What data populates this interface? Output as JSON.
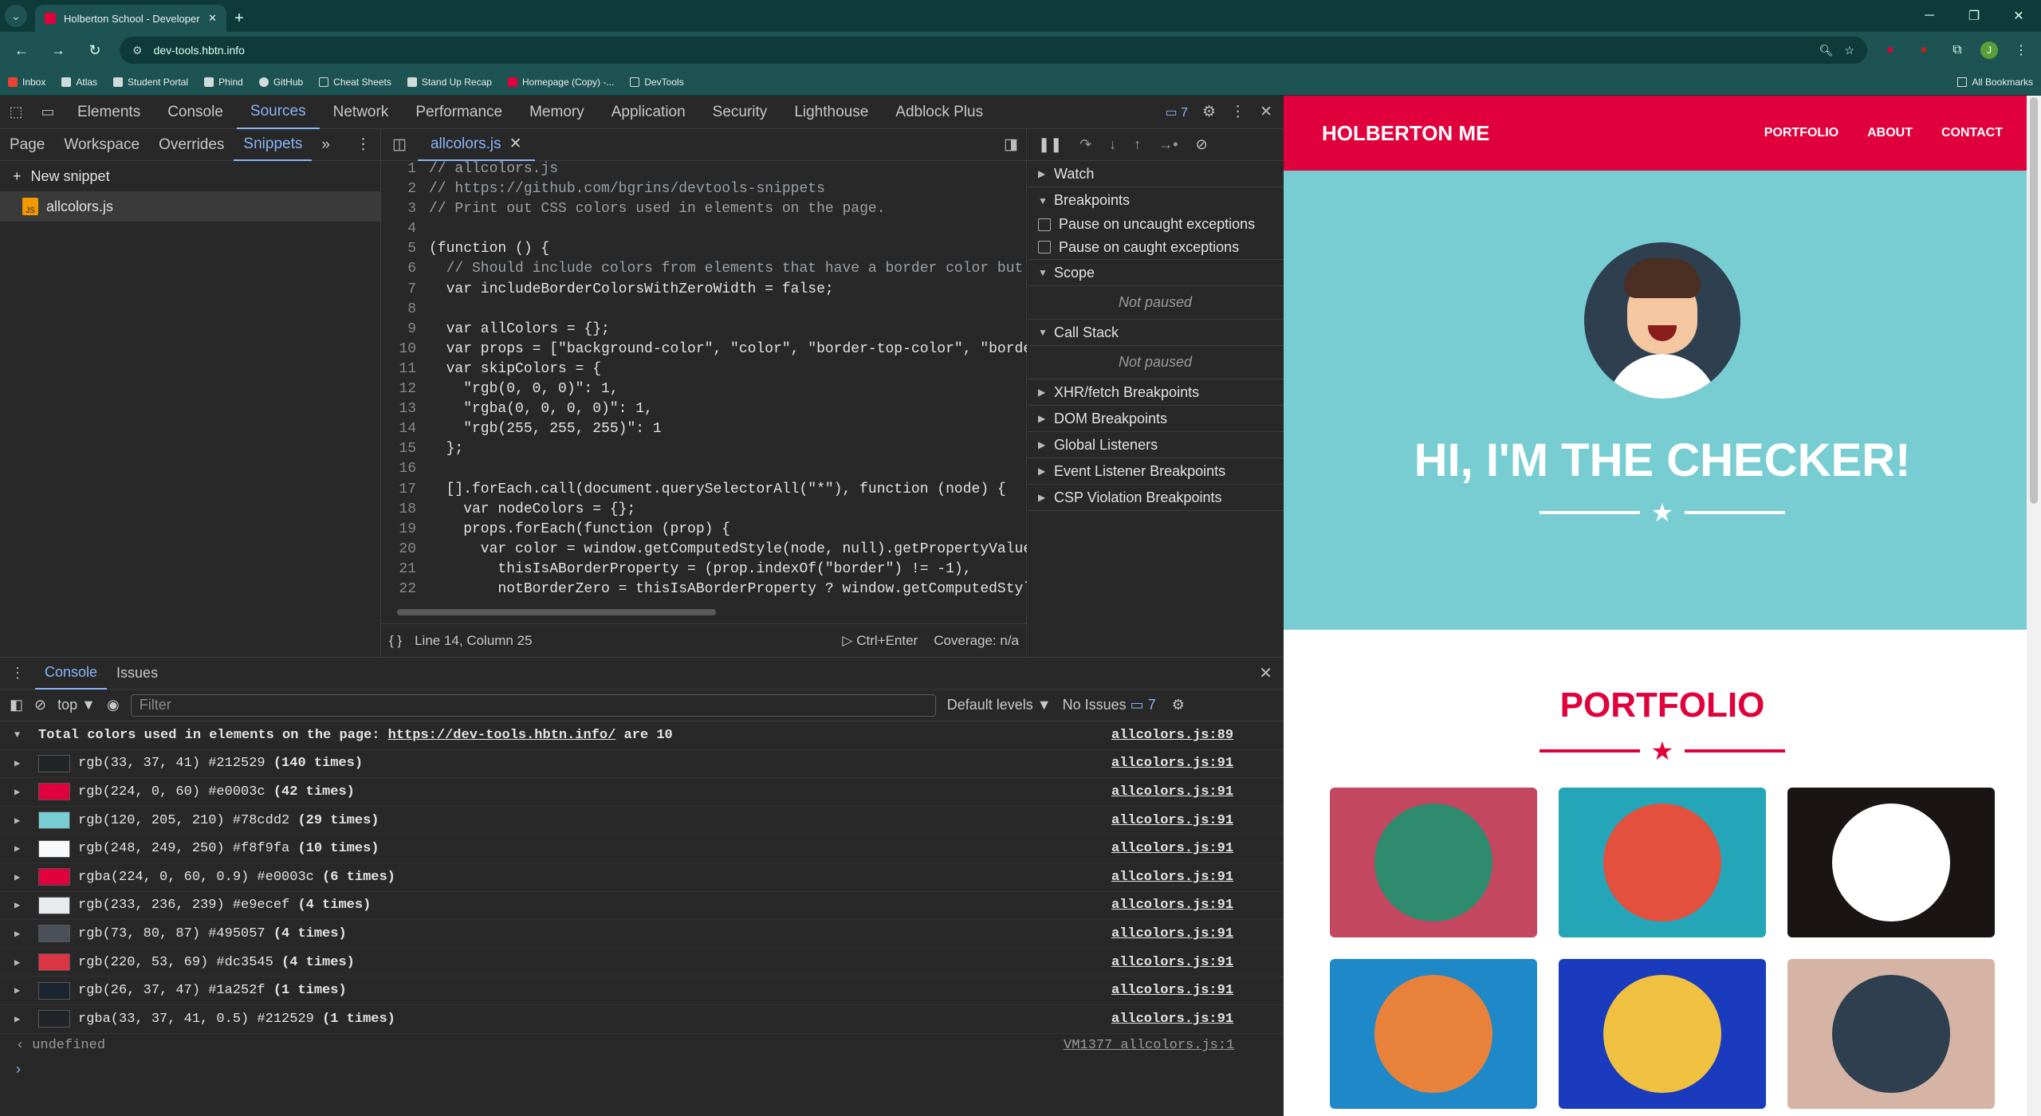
{
  "browser": {
    "tab_title": "Holberton School - Developer",
    "url": "dev-tools.hbtn.info",
    "bookmarks": [
      "Inbox",
      "Atlas",
      "Student Portal",
      "Phind",
      "GitHub",
      "Cheat Sheets",
      "Stand Up Recap",
      "Homepage (Copy) -...",
      "DevTools"
    ],
    "all_bookmarks": "All Bookmarks",
    "profile_initial": "J"
  },
  "devtools": {
    "tabs": [
      "Elements",
      "Console",
      "Sources",
      "Network",
      "Performance",
      "Memory",
      "Application",
      "Security",
      "Lighthouse",
      "Adblock Plus"
    ],
    "active_tab": "Sources",
    "issues_badge": "7",
    "nav_tabs": [
      "Page",
      "Workspace",
      "Overrides",
      "Snippets"
    ],
    "new_snippet": "New snippet",
    "snippet_file": "allcolors.js",
    "editor_tab": "allcolors.js",
    "code_lines": [
      "// allcolors.js",
      "// https://github.com/bgrins/devtools-snippets",
      "// Print out CSS colors used in elements on the page.",
      "",
      "(function () {",
      "  // Should include colors from elements that have a border color but h",
      "  var includeBorderColorsWithZeroWidth = false;",
      "",
      "  var allColors = {};",
      "  var props = [\"background-color\", \"color\", \"border-top-color\", \"border",
      "  var skipColors = {",
      "    \"rgb(0, 0, 0)\": 1,",
      "    \"rgba(0, 0, 0, 0)\": 1,",
      "    \"rgb(255, 255, 255)\": 1",
      "  };",
      "",
      "  [].forEach.call(document.querySelectorAll(\"*\"), function (node) {",
      "    var nodeColors = {};",
      "    props.forEach(function (prop) {",
      "      var color = window.getComputedStyle(node, null).getPropertyValue(",
      "        thisIsABorderProperty = (prop.indexOf(\"border\") != -1),",
      "        notBorderZero = thisIsABorderProperty ? window.getComputedStyle"
    ],
    "status_position": "Line 14, Column 25",
    "run_hint": "Ctrl+Enter",
    "coverage": "Coverage: n/a",
    "debugger": {
      "watch": "Watch",
      "breakpoints": "Breakpoints",
      "pause_uncaught": "Pause on uncaught exceptions",
      "pause_caught": "Pause on caught exceptions",
      "scope": "Scope",
      "not_paused": "Not paused",
      "call_stack": "Call Stack",
      "more_sections": [
        "XHR/fetch Breakpoints",
        "DOM Breakpoints",
        "Global Listeners",
        "Event Listener Breakpoints",
        "CSP Violation Breakpoints"
      ]
    },
    "drawer": {
      "tabs": [
        "Console",
        "Issues"
      ],
      "context": "top",
      "filter_placeholder": "Filter",
      "levels": "Default levels",
      "no_issues": "No Issues",
      "issues_count": "7",
      "summary_prefix": "Total colors used in elements on the page: ",
      "summary_link": "https://dev-tools.hbtn.info/",
      "summary_suffix": " are 10",
      "summary_src": "allcolors.js:89",
      "color_rows": [
        {
          "text": "rgb(33, 37, 41) #212529 ",
          "count": "(140 times)",
          "swatch": "#212529",
          "src": "allcolors.js:91"
        },
        {
          "text": "rgb(224, 0, 60) #e0003c ",
          "count": "(42 times)",
          "swatch": "#e0003c",
          "src": "allcolors.js:91"
        },
        {
          "text": "rgb(120, 205, 210) #78cdd2 ",
          "count": "(29 times)",
          "swatch": "#78cdd2",
          "src": "allcolors.js:91"
        },
        {
          "text": "rgb(248, 249, 250) #f8f9fa ",
          "count": "(10 times)",
          "swatch": "#f8f9fa",
          "src": "allcolors.js:91"
        },
        {
          "text": "rgba(224, 0, 60, 0.9) #e0003c ",
          "count": "(6 times)",
          "swatch": "#e0003c",
          "src": "allcolors.js:91"
        },
        {
          "text": "rgb(233, 236, 239) #e9ecef ",
          "count": "(4 times)",
          "swatch": "#e9ecef",
          "src": "allcolors.js:91"
        },
        {
          "text": "rgb(73, 80, 87) #495057 ",
          "count": "(4 times)",
          "swatch": "#495057",
          "src": "allcolors.js:91"
        },
        {
          "text": "rgb(220, 53, 69) #dc3545 ",
          "count": "(4 times)",
          "swatch": "#dc3545",
          "src": "allcolors.js:91"
        },
        {
          "text": "rgb(26, 37, 47) #1a252f ",
          "count": "(1 times)",
          "swatch": "#1a252f",
          "src": "allcolors.js:91"
        },
        {
          "text": "rgba(33, 37, 41, 0.5) #212529 ",
          "count": "(1 times)",
          "swatch": "#212529",
          "src": "allcolors.js:91"
        }
      ],
      "undefined_text": "undefined",
      "undefined_src": "VM1377 allcolors.js:1"
    }
  },
  "page": {
    "brand": "HOLBERTON ME",
    "nav": [
      "PORTFOLIO",
      "ABOUT",
      "CONTACT"
    ],
    "hero_title": "HI, I'M THE CHECKER!",
    "portfolio_title": "PORTFOLIO",
    "accent": "#e0003c",
    "hero_bg": "#78cdd2",
    "cards": [
      {
        "bg": "#c3475f",
        "circle": "#2e8b6e",
        "icon": "cabin-icon"
      },
      {
        "bg": "#25a5b8",
        "circle": "#e4503e",
        "icon": "cake-icon"
      },
      {
        "bg": "#1a1414",
        "circle": "#ffffff",
        "icon": "circus-tent-icon"
      },
      {
        "bg": "#1e88c8",
        "circle": "#e8823a",
        "icon": "gamepad-icon"
      },
      {
        "bg": "#1a3bbd",
        "circle": "#f0c040",
        "icon": "safe-icon"
      },
      {
        "bg": "#d5b4a6",
        "circle": "#2e3f50",
        "icon": "submarine-icon"
      }
    ]
  }
}
